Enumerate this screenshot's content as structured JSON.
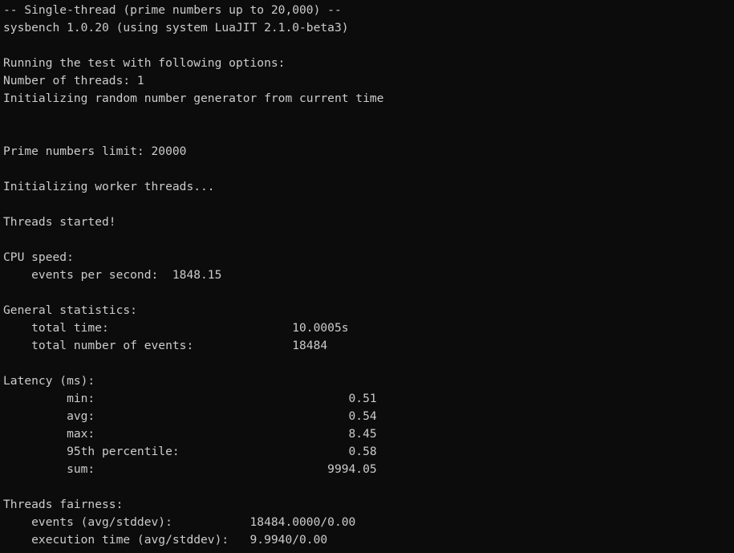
{
  "colors": {
    "background": "#0c0c0c",
    "foreground": "#cccccc"
  },
  "terminal": {
    "lines": [
      "-- Single-thread (prime numbers up to 20,000) --",
      "sysbench 1.0.20 (using system LuaJIT 2.1.0-beta3)",
      "",
      "Running the test with following options:",
      "Number of threads: 1",
      "Initializing random number generator from current time",
      "",
      "",
      "Prime numbers limit: 20000",
      "",
      "Initializing worker threads...",
      "",
      "Threads started!",
      "",
      "CPU speed:",
      "    events per second:  1848.15",
      "",
      "General statistics:",
      "    total time:                          10.0005s",
      "    total number of events:              18484",
      "",
      "Latency (ms):",
      "         min:                                    0.51",
      "         avg:                                    0.54",
      "         max:                                    8.45",
      "         95th percentile:                        0.58",
      "         sum:                                 9994.05",
      "",
      "Threads fairness:",
      "    events (avg/stddev):           18484.0000/0.00",
      "    execution time (avg/stddev):   9.9940/0.00"
    ]
  }
}
